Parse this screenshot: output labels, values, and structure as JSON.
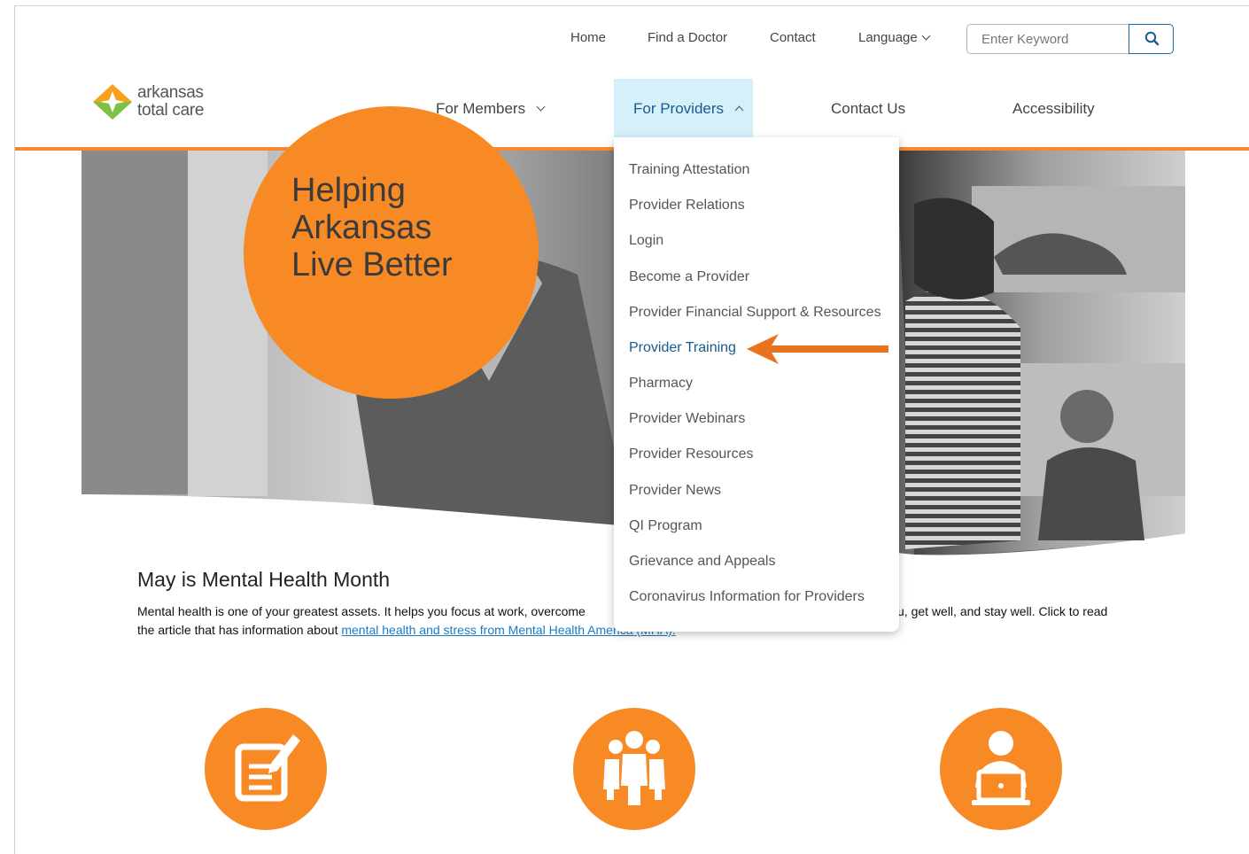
{
  "utility_nav": {
    "home": "Home",
    "find_doctor": "Find a Doctor",
    "contact": "Contact",
    "language": "Language",
    "search_placeholder": "Enter Keyword"
  },
  "logo": {
    "line1": "arkansas",
    "line2": "total care"
  },
  "main_nav": {
    "for_members": "For Members",
    "for_providers": "For Providers",
    "contact_us": "Contact Us",
    "accessibility": "Accessibility"
  },
  "hero": {
    "headline": "Helping\nArkansas\nLive Better"
  },
  "dropdown": {
    "items": [
      "Training Attestation",
      "Provider Relations",
      "Login",
      "Become a Provider",
      "Provider Financial Support & Resources",
      "Provider Training",
      "Pharmacy",
      "Provider Webinars",
      "Provider Resources",
      "Provider News",
      "QI Program",
      "Grievance and Appeals",
      "Coronavirus Information for Providers"
    ],
    "highlighted_item": "Provider Training"
  },
  "article": {
    "title": "May is Mental Health Month",
    "body_start": "Mental health is one of your greatest assets. It helps you focus at work, overcome",
    "body_visible_end": "u, get well, and stay well. Click to read",
    "body_line2": "the article that has information about ",
    "link_text": "mental health and stress from Mental Health America (MHA)."
  },
  "features": {
    "icons": [
      "document-edit-icon",
      "group-people-icon",
      "person-laptop-icon"
    ]
  },
  "colors": {
    "accent_orange": "#f7882f",
    "active_nav_bg": "#d6f0fa",
    "link_blue": "#1a7bc4",
    "highlight_blue": "#1a5a8a"
  }
}
